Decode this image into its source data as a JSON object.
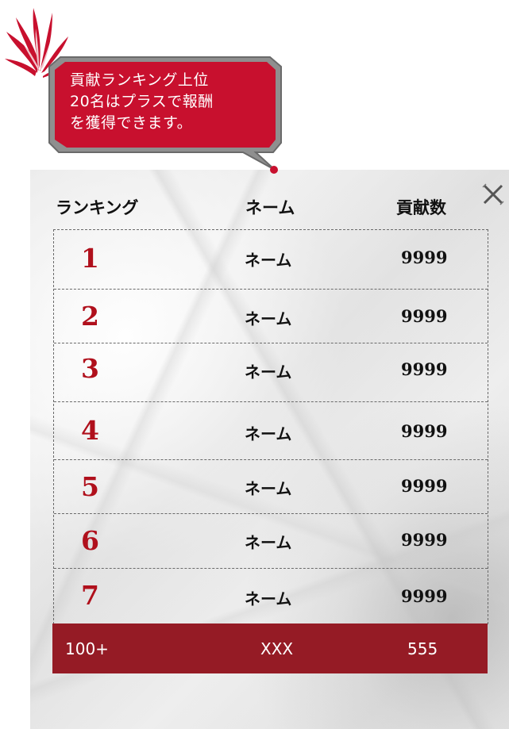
{
  "notice": {
    "lines": [
      "貢献ランキング上位",
      "20名はプラスで報酬",
      "を獲得できます。"
    ]
  },
  "table": {
    "headers": {
      "rank": "ランキング",
      "name": "ネーム",
      "score": "貢献数"
    },
    "rows": [
      {
        "rank": "1",
        "name": "ネーム",
        "score": "9999"
      },
      {
        "rank": "2",
        "name": "ネーム",
        "score": "9999"
      },
      {
        "rank": "3",
        "name": "ネーム",
        "score": "9999"
      },
      {
        "rank": "4",
        "name": "ネーム",
        "score": "9999"
      },
      {
        "rank": "5",
        "name": "ネーム",
        "score": "9999"
      },
      {
        "rank": "6",
        "name": "ネーム",
        "score": "9999"
      },
      {
        "rank": "7",
        "name": "ネーム",
        "score": "9999"
      }
    ],
    "self": {
      "rank": "100+",
      "name": "XXX",
      "score": "555"
    }
  },
  "colors": {
    "accent_red": "#b0101c",
    "self_row_bg": "#951b25",
    "bubble_red": "#c8102e"
  },
  "icons": {
    "close": "close-x-icon",
    "logo": "red-flame-logo-icon"
  }
}
